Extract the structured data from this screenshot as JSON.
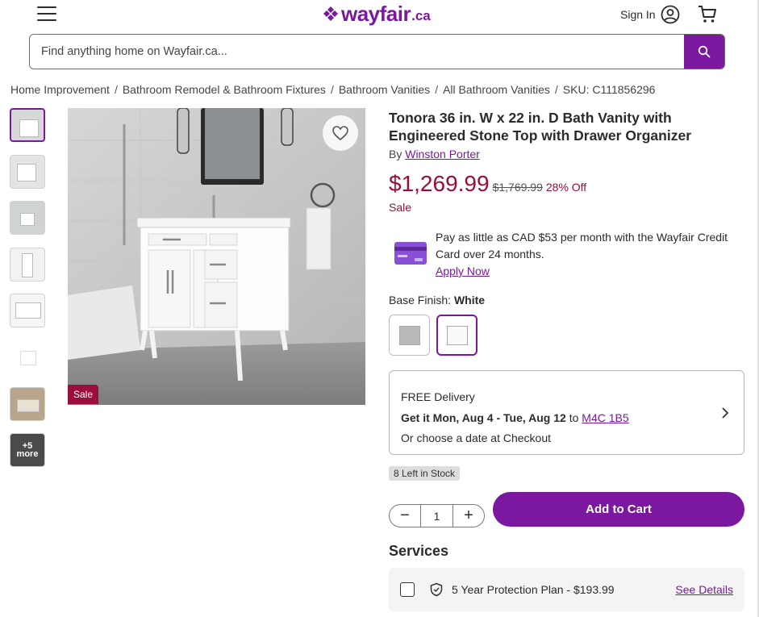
{
  "header": {
    "logo_text": "wayfair",
    "logo_tld": ".ca",
    "sign_in_label": "Sign In",
    "brand_color": "#7b189f"
  },
  "search": {
    "placeholder": "Find anything home on Wayfair.ca..."
  },
  "breadcrumb": {
    "items": [
      "Home Improvement",
      "Bathroom Remodel & Bathroom Fixtures",
      "Bathroom Vanities",
      "All Bathroom Vanities"
    ],
    "sku": "SKU: C111856296"
  },
  "gallery": {
    "more_label": "+5 more",
    "sale_badge": "Sale"
  },
  "product": {
    "title": "Tonora 36 in. W x 22 in. D Bath Vanity with Engineered Stone Top with Drawer Organizer",
    "by_prefix": "By",
    "brand": "Winston Porter",
    "price": "$1,269.99",
    "was_price": "$1,769.99",
    "discount": "28% Off",
    "sale_label": "Sale",
    "sale_color": "#9b0d3a"
  },
  "credit": {
    "text": "Pay as little as CAD $53 per month with the Wayfair Credit Card over 24 months.",
    "apply_label": "Apply Now"
  },
  "finish": {
    "label": "Base Finish:",
    "selected": "White",
    "options": [
      "Gray",
      "White"
    ]
  },
  "delivery": {
    "line1": "FREE Delivery",
    "line2_bold": "Get it Mon, Aug 4 - Tue, Aug 12",
    "line2_to": "to",
    "postal": "M4C 1B5",
    "line3": "Or choose a date at Checkout"
  },
  "stock": {
    "label": "8 Left in Stock"
  },
  "cart": {
    "quantity": "1",
    "minus": "−",
    "plus": "+",
    "add_label": "Add to Cart"
  },
  "services": {
    "heading": "Services",
    "plan": "5 Year Protection Plan - $193.99",
    "details_label": "See Details"
  }
}
